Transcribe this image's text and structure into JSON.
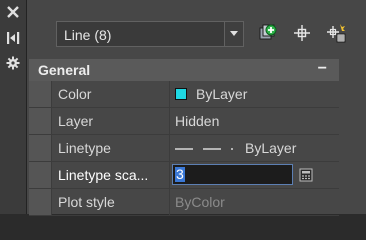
{
  "selector": {
    "value": "Line (8)"
  },
  "section": {
    "title": "General",
    "collapse_symbol": "−"
  },
  "properties": [
    {
      "name": "Color",
      "value": "ByLayer",
      "swatch": "#1fd8e3"
    },
    {
      "name": "Layer",
      "value": "Hidden"
    },
    {
      "name": "Linetype",
      "value": "ByLayer"
    },
    {
      "name": "Linetype sca...",
      "value": "3"
    },
    {
      "name": "Plot style",
      "value": "ByColor"
    }
  ],
  "icons": {
    "close": "close-icon",
    "autohide": "autohide-icon",
    "settings": "gear-icon",
    "quickselect": "quick-select-icon",
    "pickadd": "pick-add-icon",
    "select": "select-objects-icon",
    "calculator": "calculator-icon"
  }
}
